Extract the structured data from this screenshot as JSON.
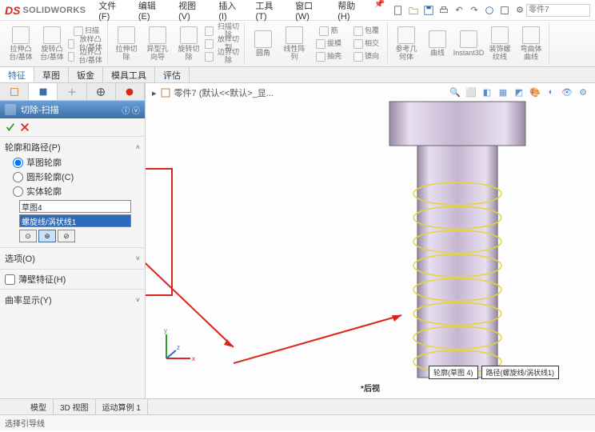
{
  "app": {
    "name": "SOLIDWORKS",
    "doc": "零件7"
  },
  "menu": [
    "文件(F)",
    "编辑(E)",
    "视图(V)",
    "插入(I)",
    "工具(T)",
    "窗口(W)",
    "帮助(H)"
  ],
  "ribbon": {
    "g1": [
      {
        "l1": "拉伸凸",
        "l2": "台/基体"
      },
      {
        "l1": "旋转凸",
        "l2": "台/基体"
      }
    ],
    "g1s": [
      "扫描",
      "放样凸台/基体",
      "边界凸台/基体"
    ],
    "g2": [
      {
        "l1": "拉伸切",
        "l2": "除"
      },
      {
        "l1": "异型孔",
        "l2": "向导"
      },
      {
        "l1": "旋转切",
        "l2": "除"
      }
    ],
    "g2s": [
      "扫描切除",
      "放样切割",
      "边界切除"
    ],
    "g3": [
      {
        "l1": "圆角",
        "l2": ""
      },
      {
        "l1": "线性阵",
        "l2": "列"
      }
    ],
    "g3s": [
      "筋",
      "拔模",
      "抽壳"
    ],
    "g3s2": [
      "包覆",
      "相交",
      "镜向"
    ],
    "g4": [
      {
        "l1": "参考几",
        "l2": "何体"
      },
      {
        "l1": "曲线",
        "l2": ""
      },
      {
        "l1": "Instant3D",
        "l2": ""
      },
      {
        "l1": "装饰螺",
        "l2": "纹线"
      },
      {
        "l1": "弯曲体",
        "l2": "曲线"
      }
    ]
  },
  "tabs": [
    "特征",
    "草图",
    "钣金",
    "模具工具",
    "评估"
  ],
  "feature": {
    "title": "切除-扫描",
    "s1": {
      "title": "轮廓和路径(P)",
      "r1": "草图轮廓",
      "r2": "圆形轮廓(C)",
      "r3": "实体轮廓",
      "sel1": "草图4",
      "sel2": "螺旋线/涡状线1"
    },
    "s2": "选项(O)",
    "s3": "薄壁特征(H)",
    "s4": "曲率显示(Y)"
  },
  "breadcrumb": "零件7  (默认<<默认>_显...",
  "labels": {
    "a": "轮廓(草图 4)",
    "b": "路径(螺旋线/涡状线1)"
  },
  "viewname": "*后视",
  "btabs": [
    "模型",
    "3D 视图",
    "运动算例 1"
  ],
  "status": "选择引导线"
}
